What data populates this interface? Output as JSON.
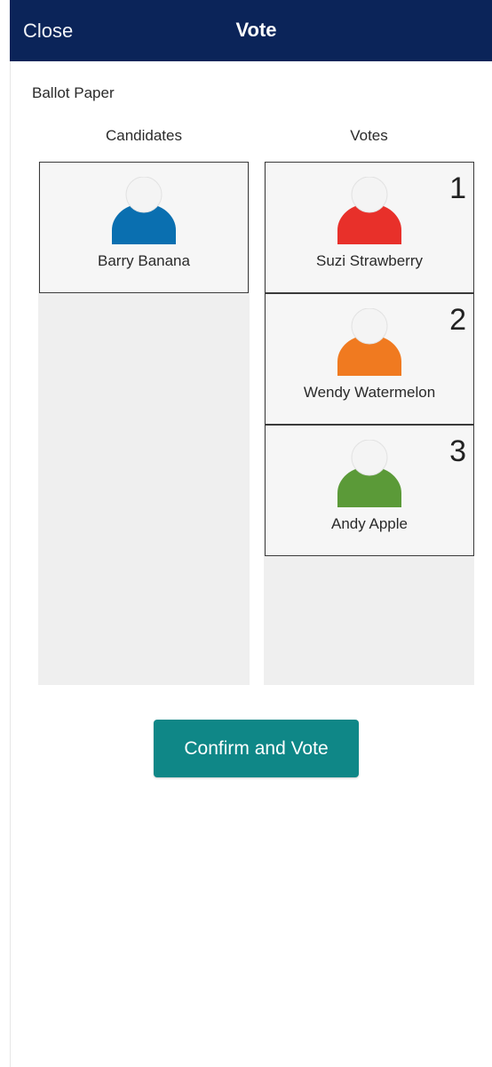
{
  "header": {
    "close_label": "Close",
    "title": "Vote"
  },
  "ballot": {
    "label": "Ballot Paper"
  },
  "columns": {
    "candidates": "Candidates",
    "votes": "Votes"
  },
  "candidates": [
    {
      "name": "Barry Banana",
      "color": "#0a6fb0"
    }
  ],
  "votes": [
    {
      "rank": "1",
      "name": "Suzi Strawberry",
      "color": "#e8302a"
    },
    {
      "rank": "2",
      "name": "Wendy Watermelon",
      "color": "#f07a20"
    },
    {
      "rank": "3",
      "name": "Andy Apple",
      "color": "#5b9a38"
    }
  ],
  "actions": {
    "confirm_label": "Confirm and Vote"
  }
}
